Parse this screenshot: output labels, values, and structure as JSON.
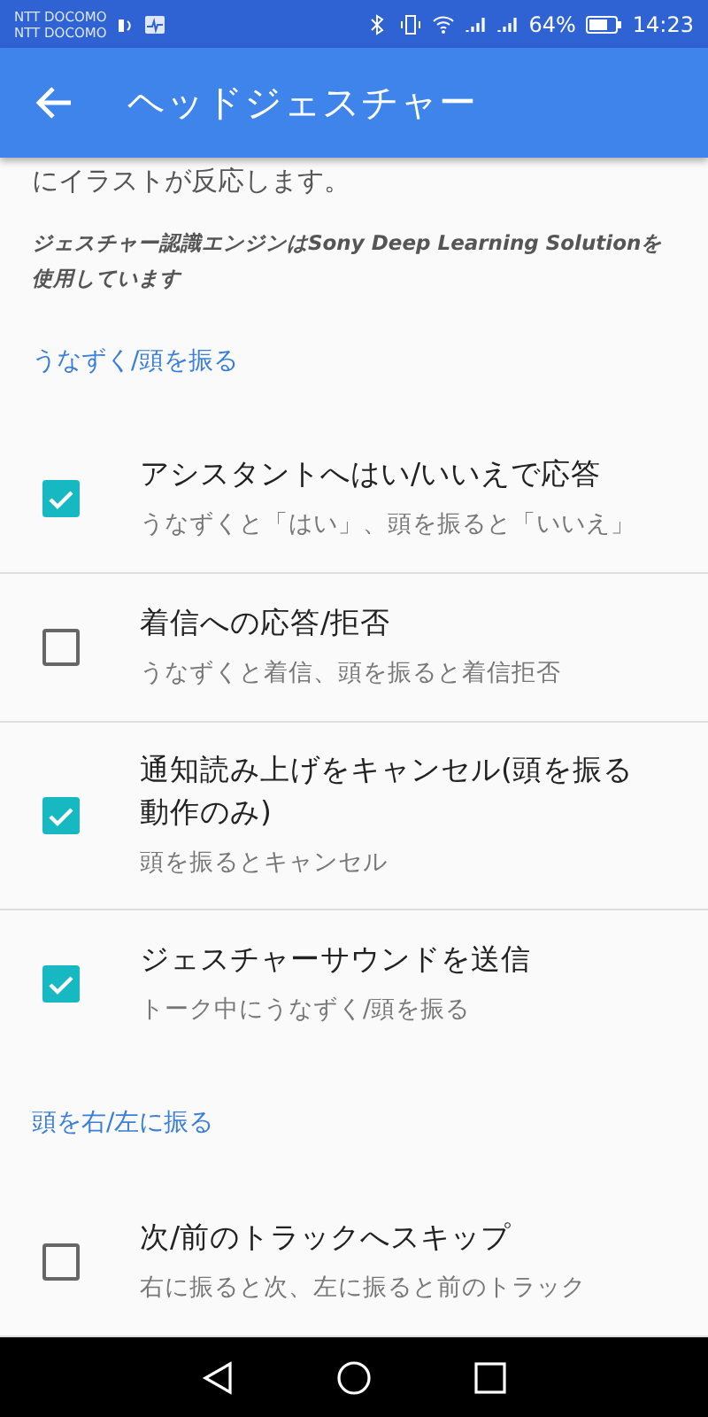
{
  "status_bar": {
    "carriers": [
      "NTT DOCOMO",
      "NTT DOCOMO"
    ],
    "battery_percent": "64%",
    "time": "14:23"
  },
  "app_bar": {
    "title": "ヘッドジェスチャー"
  },
  "intro": {
    "text": "にイラストが反応します。",
    "note": "ジェスチャー認識エンジンはSony Deep Learning Solutionを使用しています"
  },
  "sections": [
    {
      "header": "うなずく/頭を振る",
      "items": [
        {
          "title": "アシスタントへはい/いいえで応答",
          "summary": "うなずくと「はい」、頭を振ると「いいえ」",
          "checked": true
        },
        {
          "title": "着信への応答/拒否",
          "summary": "うなずくと着信、頭を振ると着信拒否",
          "checked": false
        },
        {
          "title": "通知読み上げをキャンセル(頭を振る動作のみ)",
          "summary": "頭を振るとキャンセル",
          "checked": true
        },
        {
          "title": "ジェスチャーサウンドを送信",
          "summary": "トーク中にうなずく/頭を振る",
          "checked": true
        }
      ]
    },
    {
      "header": "頭を右/左に振る",
      "items": [
        {
          "title": "次/前のトラックへスキップ",
          "summary": "右に振ると次、左に振ると前のトラック",
          "checked": false
        }
      ]
    }
  ]
}
